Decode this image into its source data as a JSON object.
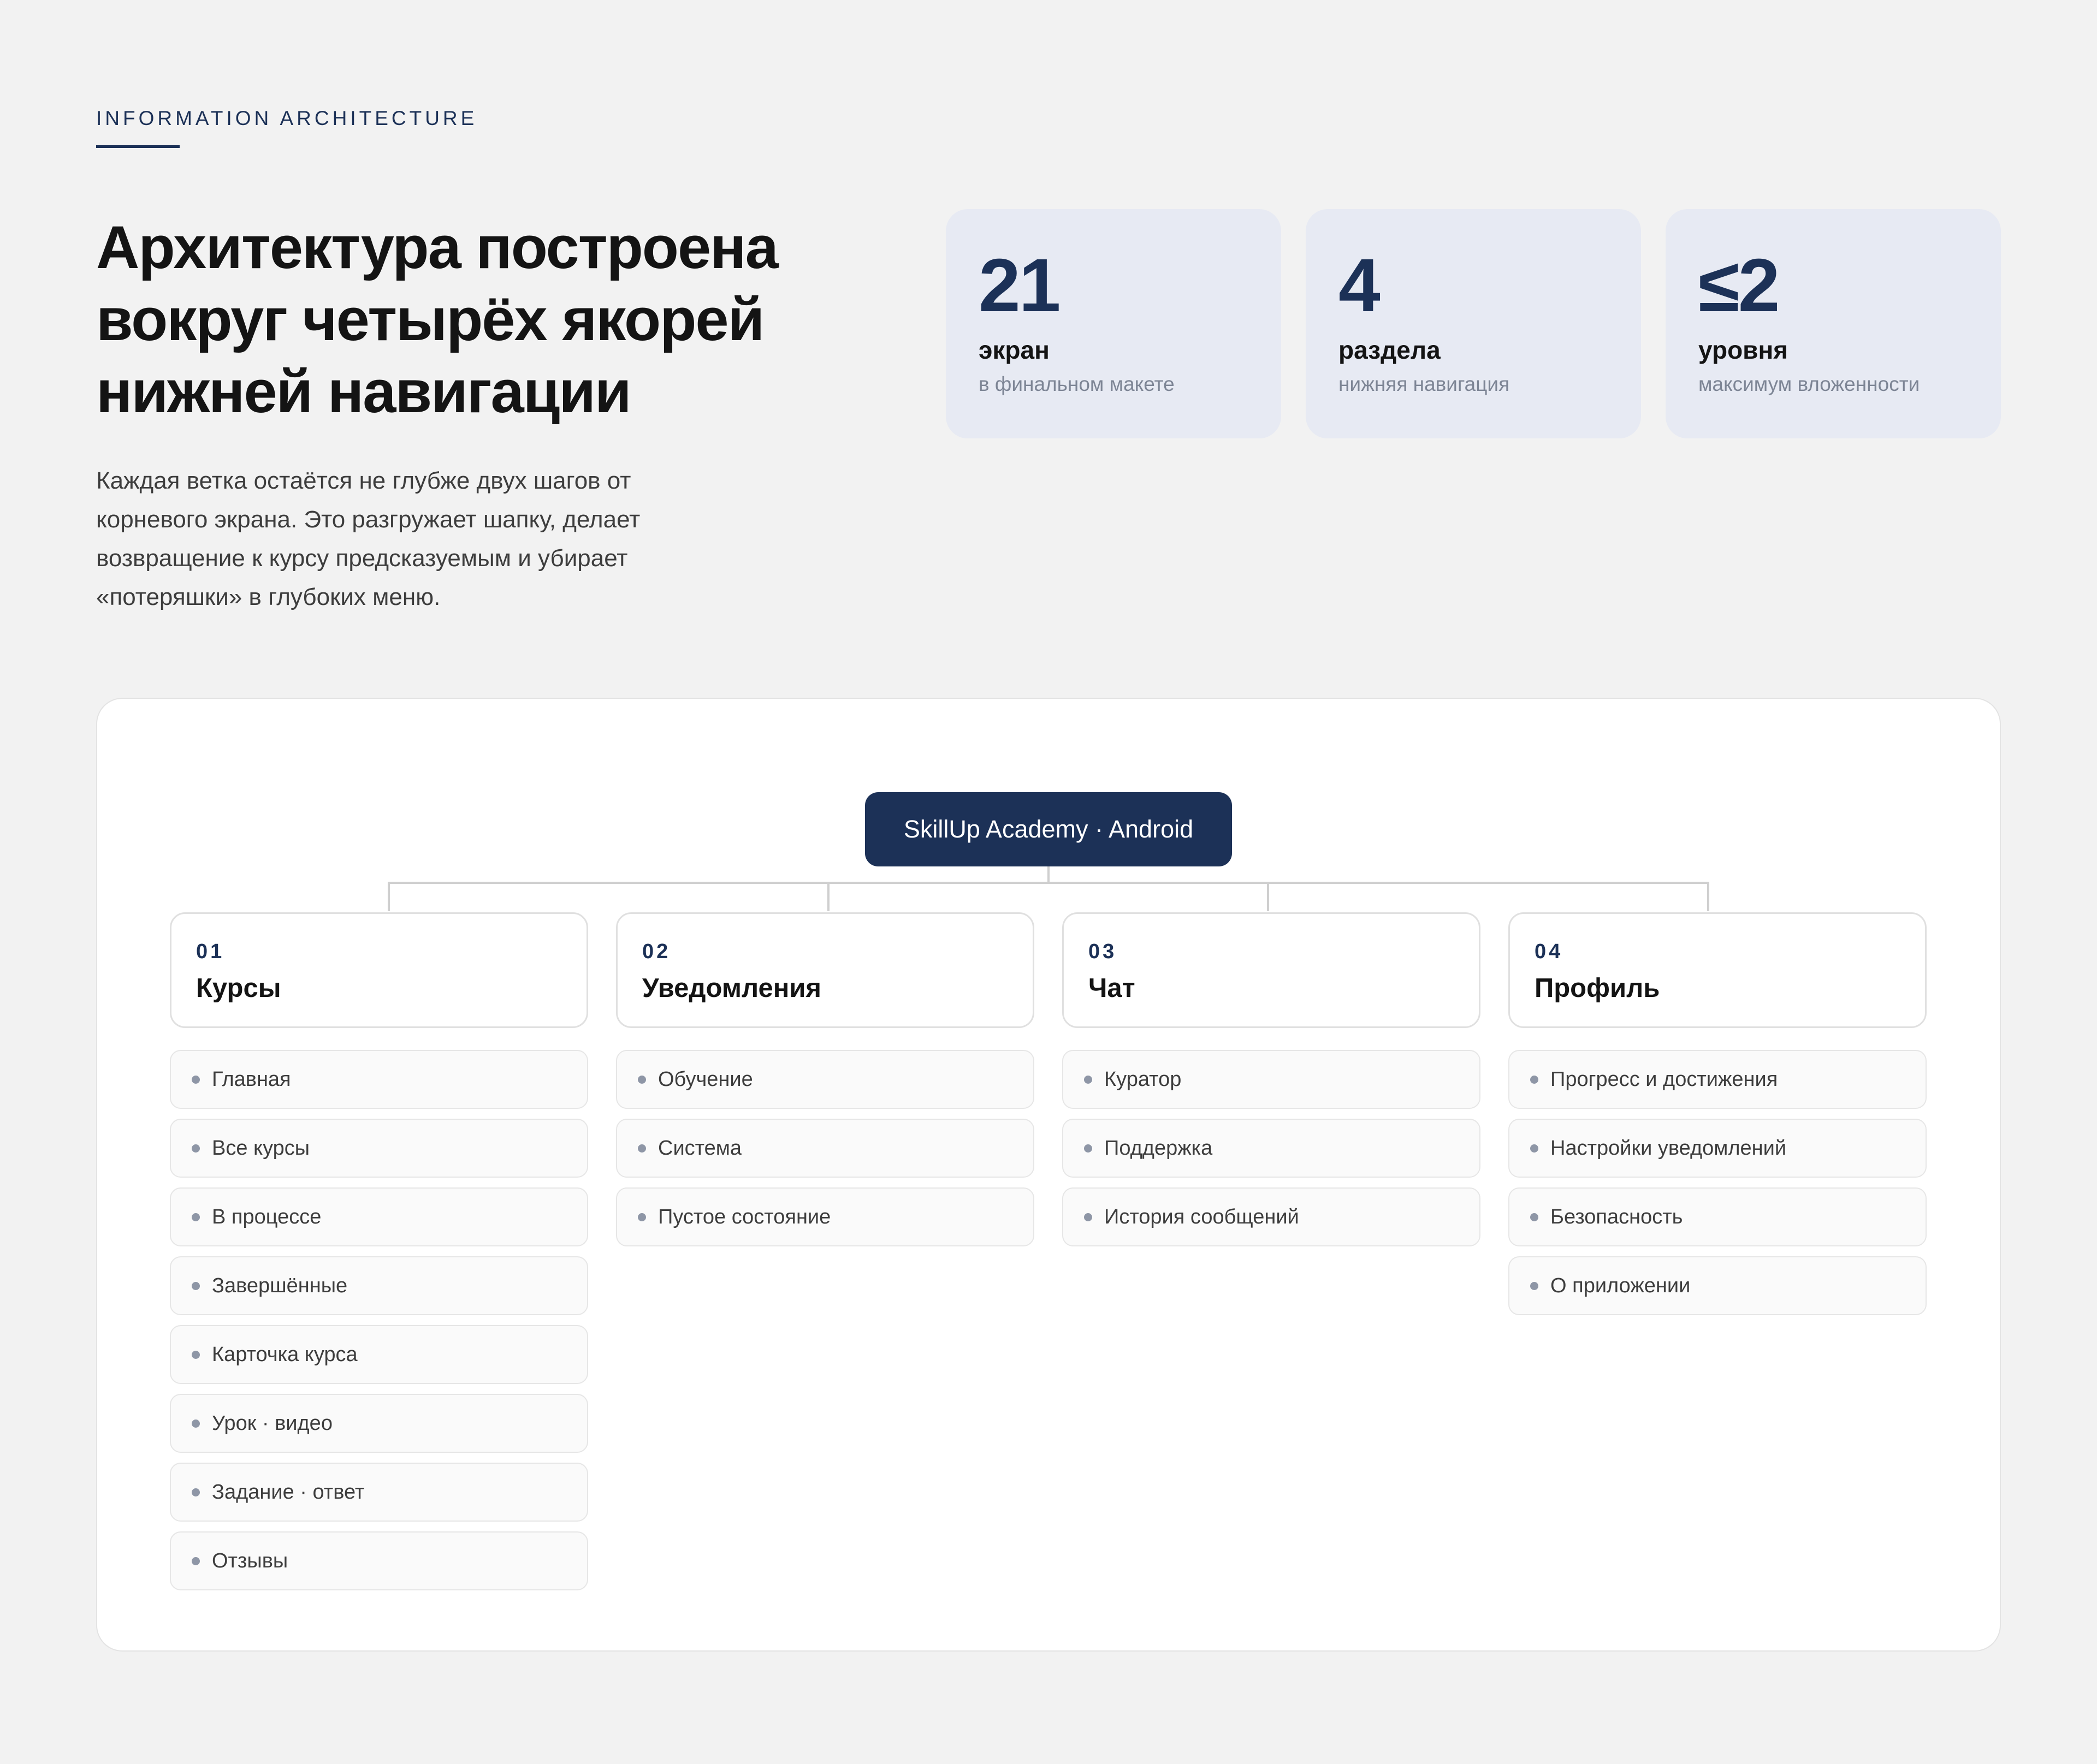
{
  "header": {
    "eyebrow": "INFORMATION ARCHITECTURE",
    "headline": "Архитектура построена вокруг четырёх якорей нижней навигации",
    "lead": "Каждая ветка остаётся не глубже двух шагов от корневого экрана. Это разгружает шапку, делает возвращение к курсу предсказуемым и убирает «потеряшки» в глубоких меню."
  },
  "stats": [
    {
      "value": "21",
      "label": "экран",
      "caption": "в финальном макете"
    },
    {
      "value": "4",
      "label": "раздела",
      "caption": "нижняя навигация"
    },
    {
      "value": "≤2",
      "label": "уровня",
      "caption": "максимум вложенности"
    }
  ],
  "tree": {
    "root": "SkillUp Academy · Android",
    "sections": [
      {
        "number": "01",
        "title": "Курсы",
        "items": [
          "Главная",
          "Все курсы",
          "В процессе",
          "Завершённые",
          "Карточка курса",
          "Урок · видео",
          "Задание · ответ",
          "Отзывы"
        ]
      },
      {
        "number": "02",
        "title": "Уведомления",
        "items": [
          "Обучение",
          "Система",
          "Пустое состояние"
        ]
      },
      {
        "number": "03",
        "title": "Чат",
        "items": [
          "Куратор",
          "Поддержка",
          "История сообщений"
        ]
      },
      {
        "number": "04",
        "title": "Профиль",
        "items": [
          "Прогресс и достижения",
          "Настройки уведомлений",
          "Безопасность",
          "О приложении"
        ]
      }
    ]
  },
  "colors": {
    "accent": "#1c3157",
    "card": "#e7eaf3",
    "background": "#f2f2f2",
    "connector": "#cfcfcf"
  }
}
